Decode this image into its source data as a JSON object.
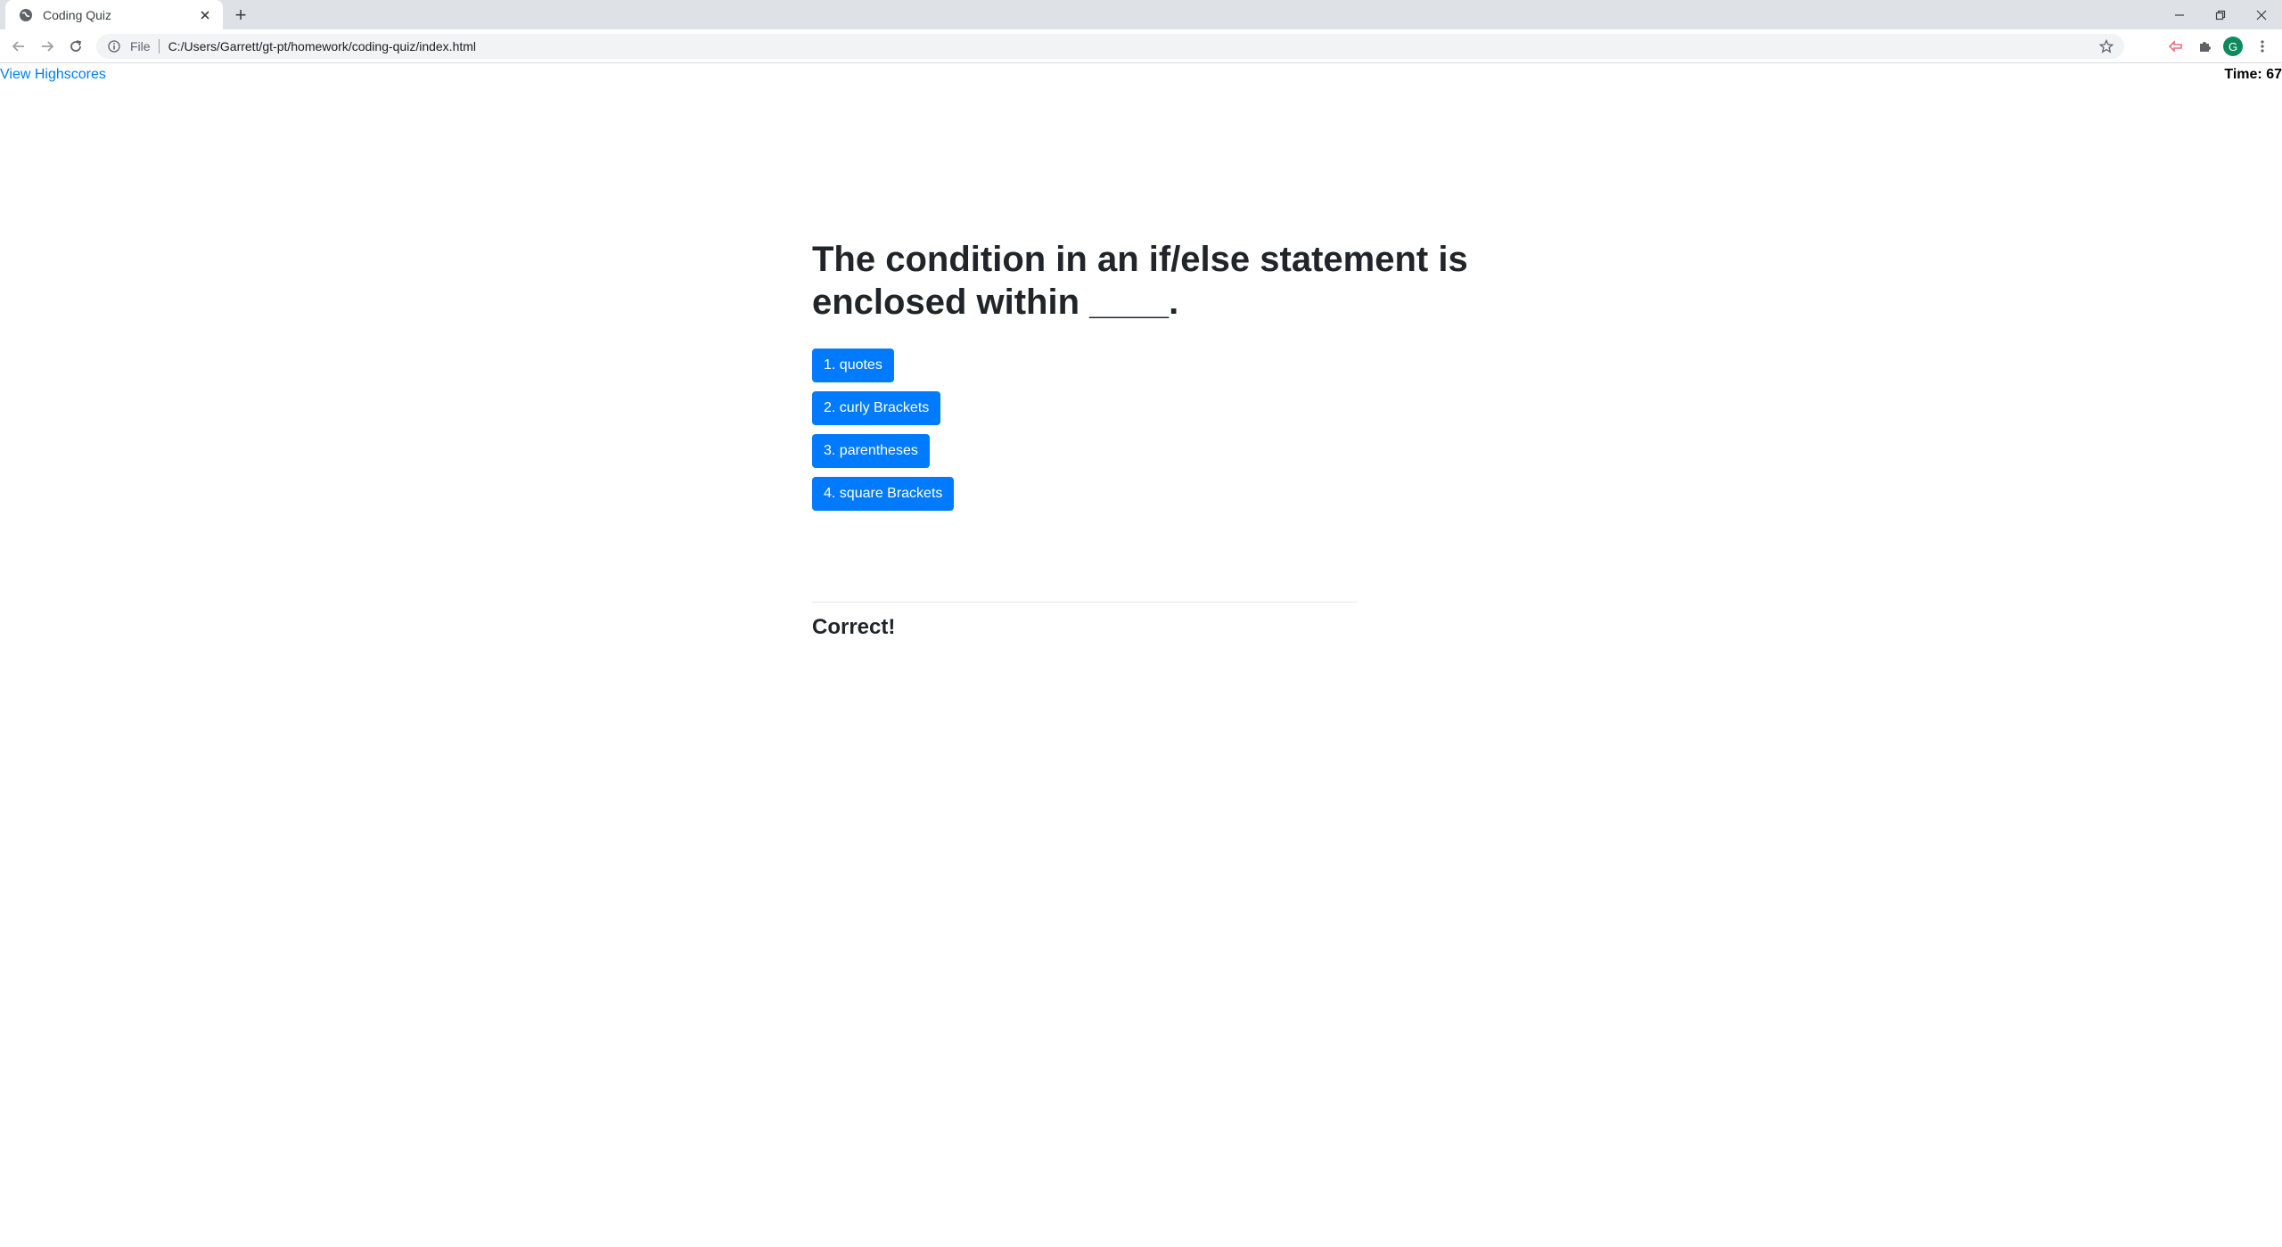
{
  "browser": {
    "tab_title": "Coding Quiz",
    "new_tab": "+",
    "file_label": "File",
    "url": "C:/Users/Garrett/gt-pt/homework/coding-quiz/index.html",
    "avatar_initial": "G"
  },
  "header": {
    "highscores_link": "View Highscores",
    "timer": "Time: 67"
  },
  "quiz": {
    "question": "The condition in an if/else statement is enclosed within ____.",
    "choices": [
      "1. quotes",
      "2. curly Brackets",
      "3. parentheses",
      "4. square Brackets"
    ],
    "result": "Correct!"
  },
  "colors": {
    "primary": "#007bff",
    "tabstrip": "#dee1e6",
    "text": "#212529"
  },
  "icons": [
    "globe-icon",
    "close-icon",
    "back-icon",
    "forward-icon",
    "reload-icon",
    "info-icon",
    "star-icon",
    "extension-icon",
    "puzzle-icon",
    "menu-icon"
  ]
}
